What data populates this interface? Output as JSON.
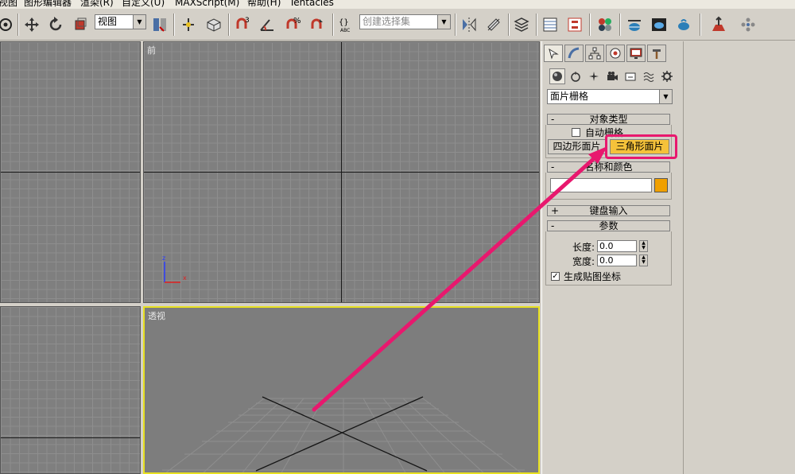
{
  "menu": {
    "items": [
      "视图",
      "图形编辑器",
      "渲染(R)",
      "自定义(U)",
      "MAXScript(M)",
      "帮助(H)",
      "Tentacles"
    ]
  },
  "toolbar": {
    "view_combo": "视图",
    "selection_set_placeholder": "创建选择集",
    "snap_labels": [
      "3",
      "%"
    ]
  },
  "viewports": {
    "front_label": "前",
    "perspective_label": "透视",
    "axis_z": "z",
    "axis_x": "x"
  },
  "command_panel": {
    "category_dropdown": "面片栅格",
    "object_type": {
      "header": "对象类型",
      "collapse": "-",
      "auto_grid_label": "自动栅格",
      "auto_grid_checked": false,
      "quad_patch_button": "四边形面片",
      "tri_patch_button": "三角形面片"
    },
    "name_color": {
      "header": "名称和颜色",
      "collapse": "-",
      "name_value": "",
      "swatch_color": "#f0a000"
    },
    "keyboard_entry": {
      "header": "键盘输入",
      "expand": "+"
    },
    "parameters": {
      "header": "参数",
      "collapse": "-",
      "length_label": "长度:",
      "length_value": "0.0",
      "width_label": "宽度:",
      "width_value": "0.0",
      "gen_mapping_label": "生成贴图坐标",
      "gen_mapping_checked": true
    }
  },
  "colors": {
    "highlight": "#e8186e",
    "active_button": "#f5c23a",
    "active_viewport_border": "#e8e020"
  }
}
